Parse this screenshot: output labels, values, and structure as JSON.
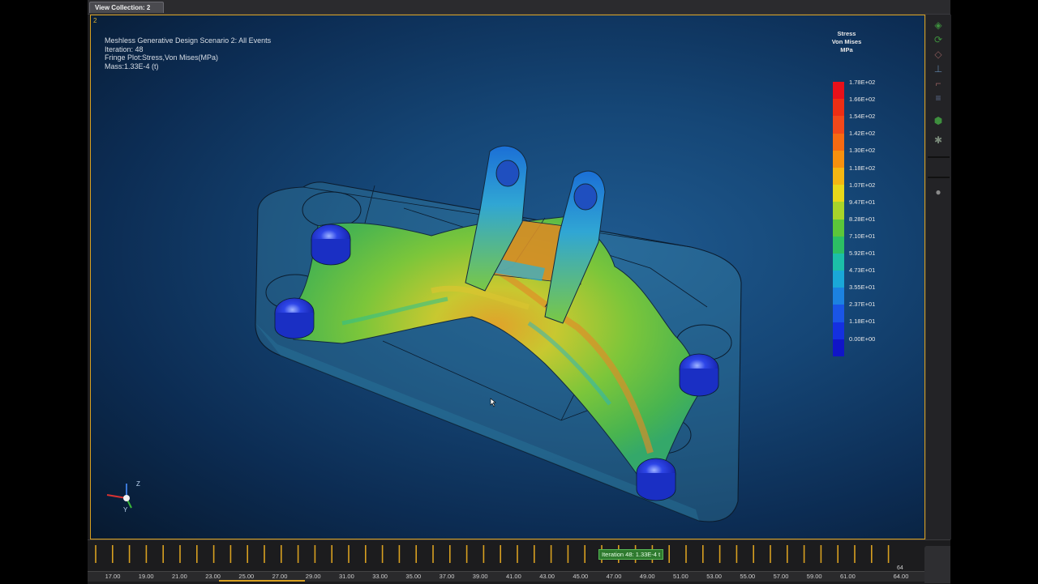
{
  "tab": {
    "label": "View Collection: 2"
  },
  "viewport": {
    "index": "2",
    "info_lines": [
      "Meshless Generative Design Scenario 2: All Events",
      "Iteration: 48",
      "Fringe Plot:Stress,Von Mises(MPa)",
      "Mass:1.33E-4 (t)"
    ]
  },
  "legend": {
    "title_lines": [
      "Stress",
      "Von Mises",
      "MPa"
    ],
    "labels": [
      "1.78E+02",
      "1.66E+02",
      "1.54E+02",
      "1.42E+02",
      "1.30E+02",
      "1.18E+02",
      "1.07E+02",
      "9.47E+01",
      "8.28E+01",
      "7.10E+01",
      "5.92E+01",
      "4.73E+01",
      "3.55E+01",
      "2.37E+01",
      "1.18E+01",
      "0.00E+00"
    ],
    "colors": [
      "#e8101a",
      "#ee2e14",
      "#f2481a",
      "#f56a12",
      "#f6900e",
      "#f4b612",
      "#e8d81a",
      "#a8d42a",
      "#5cc63a",
      "#2cbf64",
      "#1cbfa8",
      "#1aa8d8",
      "#1c82e0",
      "#1a55e6",
      "#1430e0",
      "#1015c8"
    ]
  },
  "triad": {
    "z_label": "Z",
    "y_label": "Y"
  },
  "timeline": {
    "iteration_badge": "Iteration 48: 1.33E-4 t",
    "end_label": "64",
    "scale_labels": [
      "17.00",
      "19.00",
      "21.00",
      "23.00",
      "25.00",
      "27.00",
      "29.00",
      "31.00",
      "33.00",
      "35.00",
      "37.00",
      "39.00",
      "41.00",
      "43.00",
      "45.00",
      "47.00",
      "49.00",
      "51.00",
      "53.00",
      "55.00",
      "57.00",
      "59.00",
      "61.00",
      "64.00"
    ]
  },
  "icons": {
    "right_panel": [
      "fit-view-icon",
      "rotate-view-icon",
      "view-cube-icon",
      "axis-view-icon",
      "xyz-triad-icon",
      "render-style-icon",
      "cube-shaded-icon",
      "settings-gear-icon",
      "sphere-icon"
    ]
  },
  "colors": {
    "accent_border": "#d8a020",
    "badge_green": "#2f7a2f",
    "viewport_bg": "#154676"
  }
}
